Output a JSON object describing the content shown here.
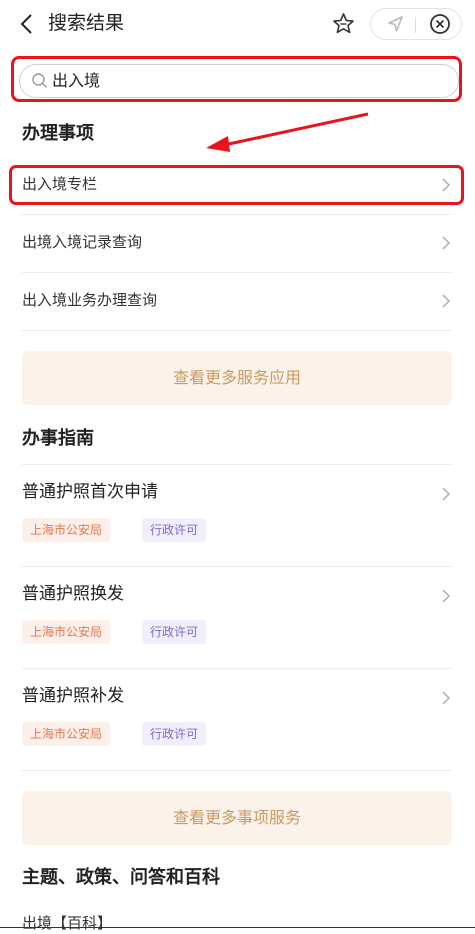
{
  "header": {
    "title": "搜索结果"
  },
  "search": {
    "query": "出入境"
  },
  "sections": {
    "affairs": {
      "title": "办理事项",
      "items": [
        {
          "label": "出入境专栏"
        },
        {
          "label": "出境入境记录查询"
        },
        {
          "label": "出入境业务办理查询"
        }
      ],
      "more_label": "查看更多服务应用"
    },
    "guides": {
      "title": "办事指南",
      "items": [
        {
          "title": "普通护照首次申请",
          "org": "上海市公安局",
          "type": "行政许可"
        },
        {
          "title": "普通护照换发",
          "org": "上海市公安局",
          "type": "行政许可"
        },
        {
          "title": "普通护照补发",
          "org": "上海市公安局",
          "type": "行政许可"
        }
      ],
      "more_label": "查看更多事项服务"
    },
    "topics": {
      "title": "主题、政策、问答和百科",
      "first_item": "出境【百科】"
    }
  },
  "annotation": {
    "color": "#e8141a"
  }
}
